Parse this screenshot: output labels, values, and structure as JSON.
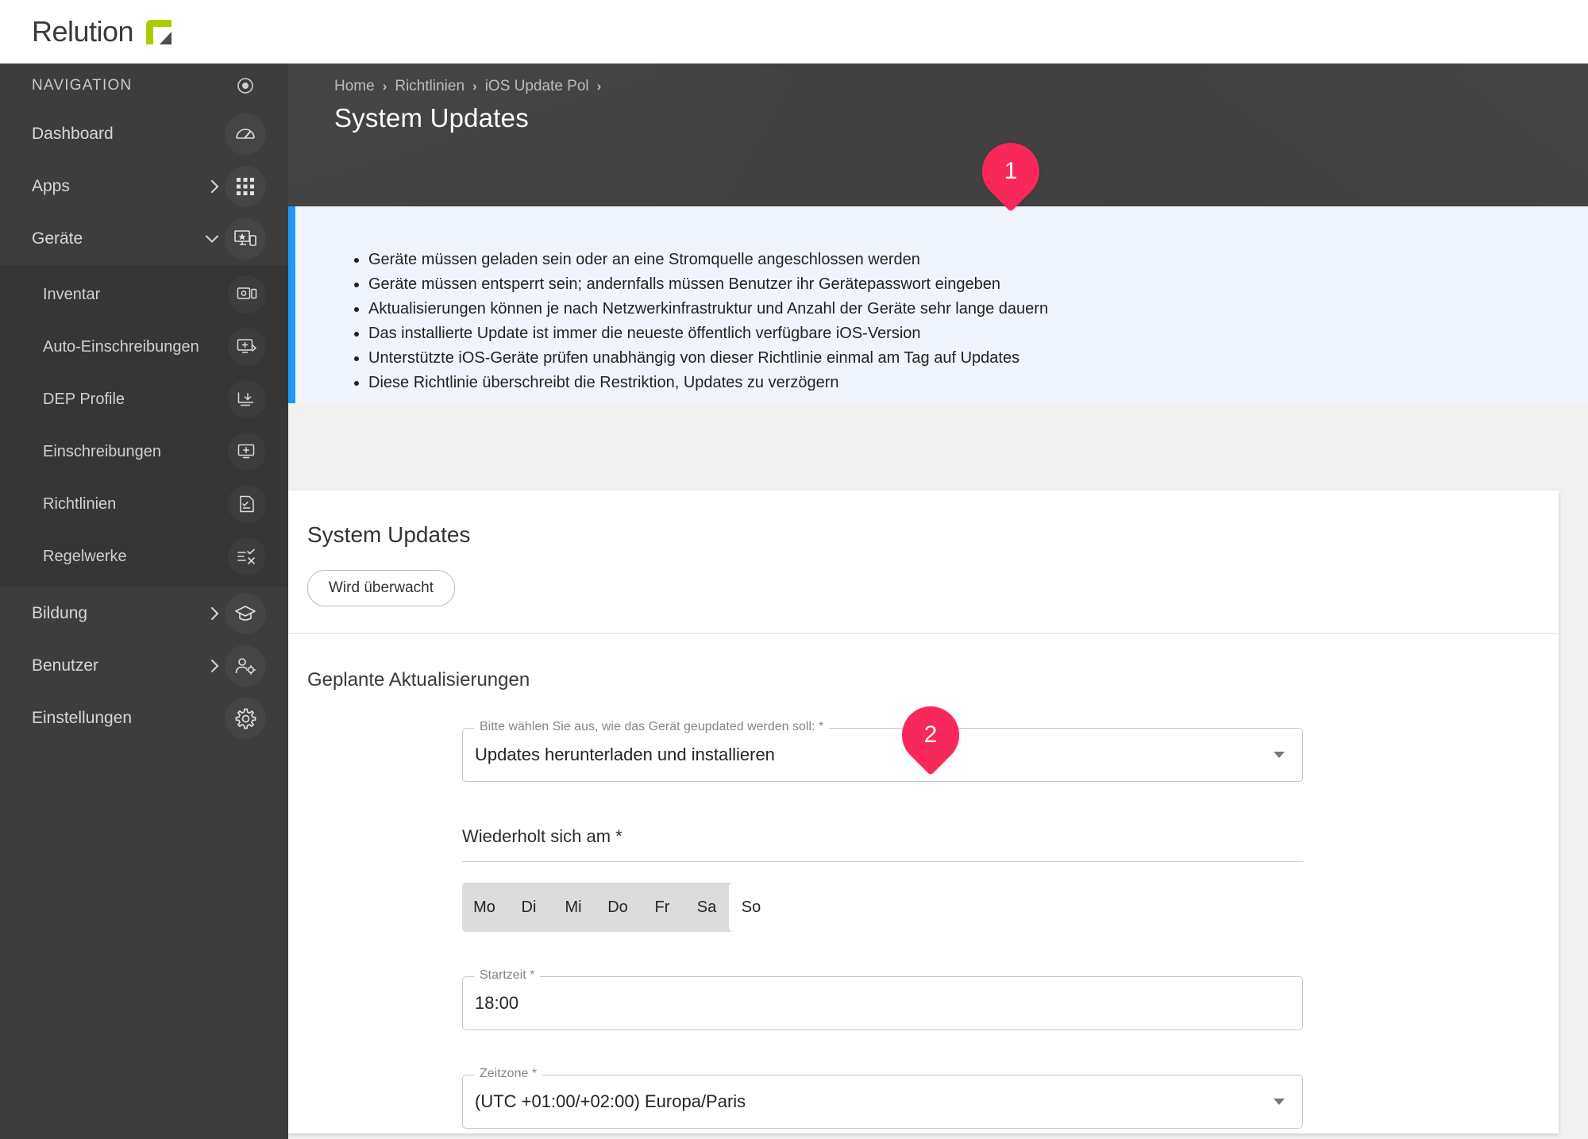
{
  "brand": {
    "name": "Relution",
    "logo_icon": "relution-logo-icon",
    "logo_colors": {
      "green": "#aacc00",
      "dark": "#4d4d4d"
    }
  },
  "sidebar": {
    "heading": "NAVIGATION",
    "heading_icon": "target-dot-icon",
    "items": [
      {
        "label": "Dashboard",
        "icon": "speedometer-icon",
        "expander": ""
      },
      {
        "label": "Apps",
        "icon": "grid-apps-icon",
        "expander": "chevron-right-icon"
      },
      {
        "label": "Geräte",
        "icon": "devices-icon",
        "expander": "chevron-down-icon"
      }
    ],
    "submenu": [
      {
        "label": "Inventar",
        "icon": "device-inventory-icon"
      },
      {
        "label": "Auto-Einschreibungen",
        "icon": "auto-enroll-icon"
      },
      {
        "label": "DEP Profile",
        "icon": "dep-download-icon"
      },
      {
        "label": "Einschreibungen",
        "icon": "enroll-plus-icon"
      },
      {
        "label": "Richtlinien",
        "icon": "policy-document-icon"
      },
      {
        "label": "Regelwerke",
        "icon": "rules-checklist-icon"
      }
    ],
    "items_bottom": [
      {
        "label": "Bildung",
        "icon": "graduation-cap-icon",
        "expander": "chevron-right-icon"
      },
      {
        "label": "Benutzer",
        "icon": "user-settings-icon",
        "expander": "chevron-right-icon"
      },
      {
        "label": "Einstellungen",
        "icon": "gear-icon",
        "expander": ""
      }
    ]
  },
  "header": {
    "breadcrumb": [
      "Home",
      "Richtlinien",
      "iOS Update Pol"
    ],
    "separator": "›",
    "title": "System Updates"
  },
  "info_panel": {
    "accent_color": "#2196f3",
    "background_color": "#f0f5fd",
    "bullets": [
      "Geräte müssen geladen sein oder an eine Stromquelle angeschlossen werden",
      "Geräte müssen entsperrt sein; andernfalls müssen Benutzer ihr Gerätepasswort eingeben",
      "Aktualisierungen können je nach Netzwerkinfrastruktur und Anzahl der Geräte sehr lange dauern",
      "Das installierte Update ist immer die neueste öffentlich verfügbare iOS-Version",
      "Unterstützte iOS-Geräte prüfen unabhängig von dieser Richtlinie einmal am Tag auf Updates",
      "Diese Richtlinie überschreibt die Restriktion, Updates zu verzögern"
    ]
  },
  "card": {
    "title": "System Updates",
    "chip_label": "Wird überwacht",
    "section_title": "Geplante Aktualisierungen",
    "fields": {
      "update_mode": {
        "label": "Bitte wählen Sie aus, wie das Gerät geupdated werden soll: *",
        "value": "Updates herunterladen und installieren"
      },
      "repeats_on": {
        "label": "Wiederholt sich am *",
        "days": [
          {
            "label": "Mo",
            "selected": false
          },
          {
            "label": "Di",
            "selected": false
          },
          {
            "label": "Mi",
            "selected": false
          },
          {
            "label": "Do",
            "selected": false
          },
          {
            "label": "Fr",
            "selected": false
          },
          {
            "label": "Sa",
            "selected": false
          },
          {
            "label": "So",
            "selected": true
          }
        ]
      },
      "start_time": {
        "label": "Startzeit *",
        "value": "18:00"
      },
      "timezone": {
        "label": "Zeitzone *",
        "value": "(UTC +01:00/+02:00) Europa/Paris"
      }
    }
  },
  "markers": [
    {
      "number": "1",
      "color": "#f8285a"
    },
    {
      "number": "2",
      "color": "#f8285a"
    }
  ]
}
